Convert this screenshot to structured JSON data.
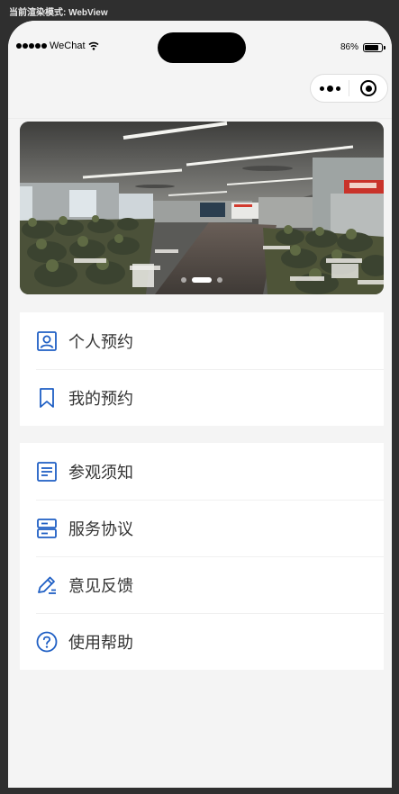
{
  "debug_label": "当前渲染模式: WebView",
  "status_bar": {
    "carrier": "WeChat",
    "battery_text": "86%",
    "battery_level": 0.86
  },
  "capsule": {
    "more_icon": "more-dots-icon",
    "close_icon": "target-circle-icon"
  },
  "banner": {
    "slide_count": 3,
    "active_index": 1,
    "image": "classroom-photo"
  },
  "menu_groups": [
    {
      "items": [
        {
          "label": "个人预约",
          "icon": "person-card-icon"
        },
        {
          "label": "我的预约",
          "icon": "bookmark-icon"
        }
      ]
    },
    {
      "items": [
        {
          "label": "参观须知",
          "icon": "document-icon"
        },
        {
          "label": "服务协议",
          "icon": "server-icon"
        },
        {
          "label": "意见反馈",
          "icon": "edit-pen-icon"
        },
        {
          "label": "使用帮助",
          "icon": "help-circle-icon"
        }
      ]
    }
  ],
  "colors": {
    "accent_icon": "#1f5fc4",
    "page_bg": "#f4f4f4",
    "frame_bg": "#2f2f2f"
  }
}
